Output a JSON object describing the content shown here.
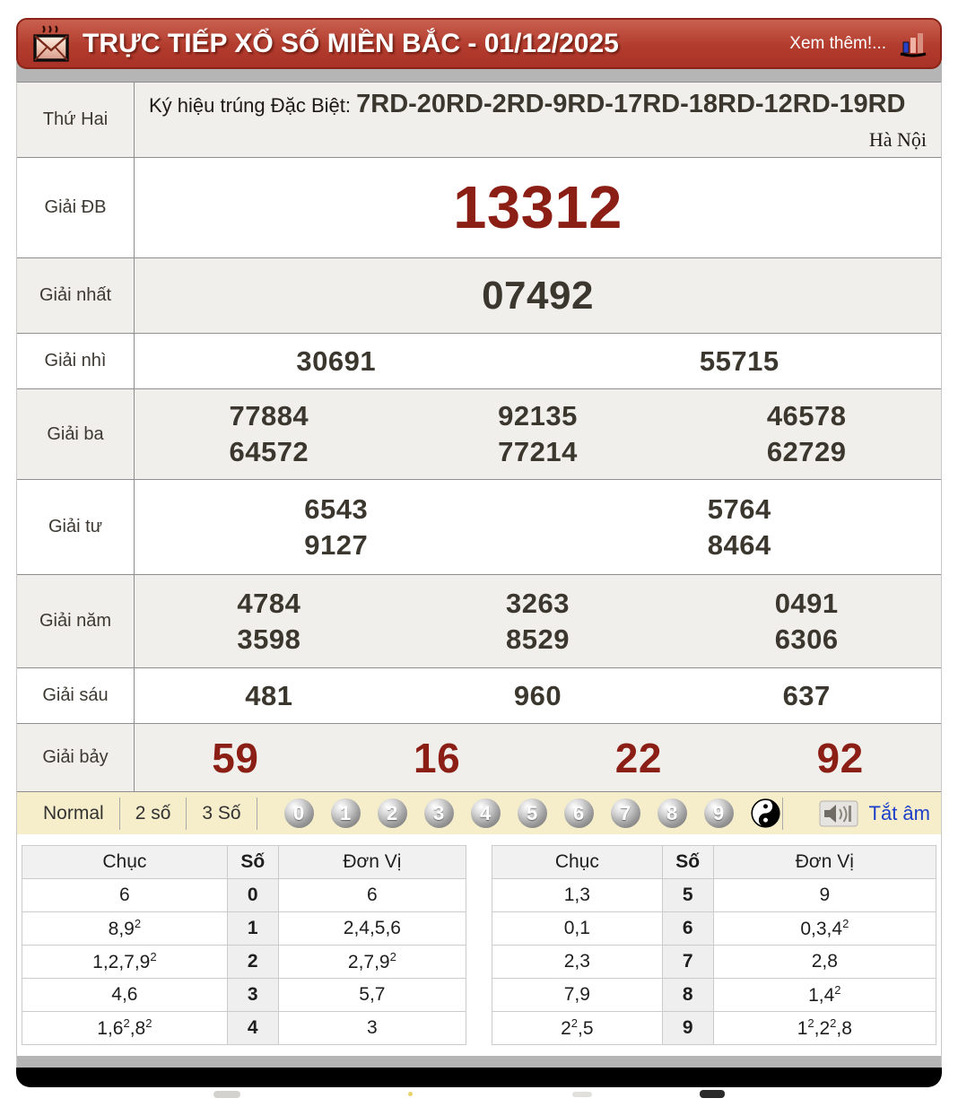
{
  "header": {
    "title": "TRỰC TIẾP XỔ SỐ MIỀN BẮC - 01/12/2025",
    "more_link": "Xem thêm!..."
  },
  "info_row": {
    "day": "Thứ Hai",
    "sign_label": "Ký hiệu trúng Đặc Biệt: ",
    "signs": "7RD-20RD-2RD-9RD-17RD-18RD-12RD-19RD",
    "region": "Hà Nội"
  },
  "prizes": [
    {
      "key": "db",
      "label": "Giải ĐB",
      "rows": [
        [
          "13312"
        ]
      ]
    },
    {
      "key": "first",
      "label": "Giải nhất",
      "rows": [
        [
          "07492"
        ]
      ]
    },
    {
      "key": "second",
      "label": "Giải nhì",
      "rows": [
        [
          "30691",
          "55715"
        ]
      ]
    },
    {
      "key": "third",
      "label": "Giải ba",
      "rows": [
        [
          "77884",
          "92135",
          "46578"
        ],
        [
          "64572",
          "77214",
          "62729"
        ]
      ]
    },
    {
      "key": "fourth",
      "label": "Giải tư",
      "rows": [
        [
          "6543",
          "5764"
        ],
        [
          "9127",
          "8464"
        ]
      ]
    },
    {
      "key": "fifth",
      "label": "Giải năm",
      "rows": [
        [
          "4784",
          "3263",
          "0491"
        ],
        [
          "3598",
          "8529",
          "6306"
        ]
      ]
    },
    {
      "key": "sixth",
      "label": "Giải sáu",
      "rows": [
        [
          "481",
          "960",
          "637"
        ]
      ]
    },
    {
      "key": "seventh",
      "label": "Giải bảy",
      "rows": [
        [
          "59",
          "16",
          "22",
          "92"
        ]
      ]
    }
  ],
  "controls": {
    "modes": [
      "Normal",
      "2 số",
      "3 Số"
    ],
    "balls": [
      "0",
      "1",
      "2",
      "3",
      "4",
      "5",
      "6",
      "7",
      "8",
      "9"
    ],
    "mute_label": "Tắt âm"
  },
  "digit_tables": {
    "headers": [
      "Chục",
      "Số",
      "Đơn Vị"
    ],
    "left": [
      {
        "tens": "6",
        "digit": "0",
        "units": "6"
      },
      {
        "tens": "8,9^2",
        "digit": "1",
        "units": "2,4,5,6"
      },
      {
        "tens": "1,2,7,9^2",
        "digit": "2",
        "units": "2,7,9^2"
      },
      {
        "tens": "4,6",
        "digit": "3",
        "units": "5,7"
      },
      {
        "tens": "1,6^2,8^2",
        "digit": "4",
        "units": "3"
      }
    ],
    "right": [
      {
        "tens": "1,3",
        "digit": "5",
        "units": "9"
      },
      {
        "tens": "0,1",
        "digit": "6",
        "units": "0,3,4^2"
      },
      {
        "tens": "2,3",
        "digit": "7",
        "units": "2,8"
      },
      {
        "tens": "7,9",
        "digit": "8",
        "units": "1,4^2"
      },
      {
        "tens": "2^2,5",
        "digit": "9",
        "units": "1^2,2^2,8"
      }
    ]
  },
  "colors": {
    "header_red": "#b23c2e",
    "header_border": "#8a2418",
    "special_maroon": "#8b1e15",
    "row_gray": "#f0efeb",
    "controls_cream": "#f6eecb",
    "link_blue": "#1c3ec8",
    "strip_gray": "#b5b5b5"
  }
}
